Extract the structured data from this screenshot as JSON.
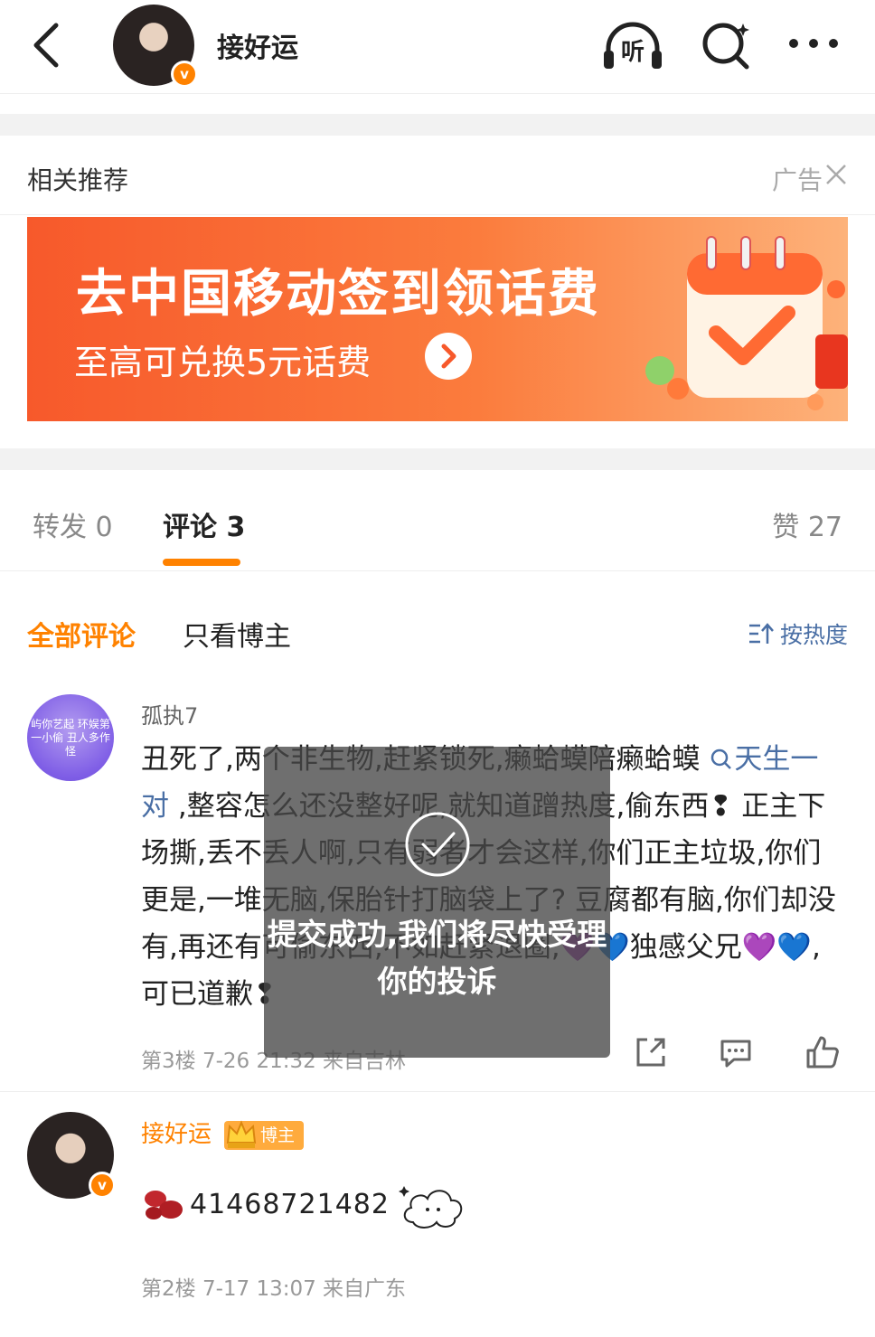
{
  "header": {
    "title": "接好运",
    "listen_label": "听",
    "verify_mark": "v"
  },
  "recommend": {
    "title": "相关推荐",
    "ad_label": "广告",
    "banner": {
      "title": "去中国移动签到领话费",
      "subtitle": "至高可兑换5元话费"
    }
  },
  "tabs": {
    "repost": "转发 0",
    "comment": "评论 3",
    "like": "赞 27"
  },
  "filters": {
    "all": "全部评论",
    "owner_only": "只看博主",
    "sort": "按热度"
  },
  "comments": [
    {
      "username": "孤执7",
      "avatar_text": "屿你艺起 环娱第一小偷 丑人多作怪",
      "text_before": "丑死了,两个非生物,赶紧锁死,癞蛤蟆陪癞蛤蟆 ",
      "hashtag": "天生一对",
      "text_after": " ,整容怎么还没整好呢,就知道蹭热度,偷东西❢ 正主下场撕,丢不丢人啊,只有弱者才会这样,你们正主垃圾,你们更是,一堆无脑,保胎针打脑袋上了? 豆腐都有脑,你们却没有,再还有可偷东西,不如赶紧退圈,💜💙独感父兄💜💙,可已道歉❢",
      "meta": "第3楼  7-26  21:32  来自吉林"
    },
    {
      "username": "接好运",
      "badge": "博主",
      "text": "41468721482",
      "meta": "第2楼  7-17  13:07  来自广东"
    }
  ],
  "toast": {
    "text": "提交成功,我们将尽快受理你的投诉"
  },
  "colors": {
    "accent": "#ff8200",
    "link": "#4a6fa5",
    "banner_start": "#f7592b",
    "banner_end": "#fdb27a"
  }
}
